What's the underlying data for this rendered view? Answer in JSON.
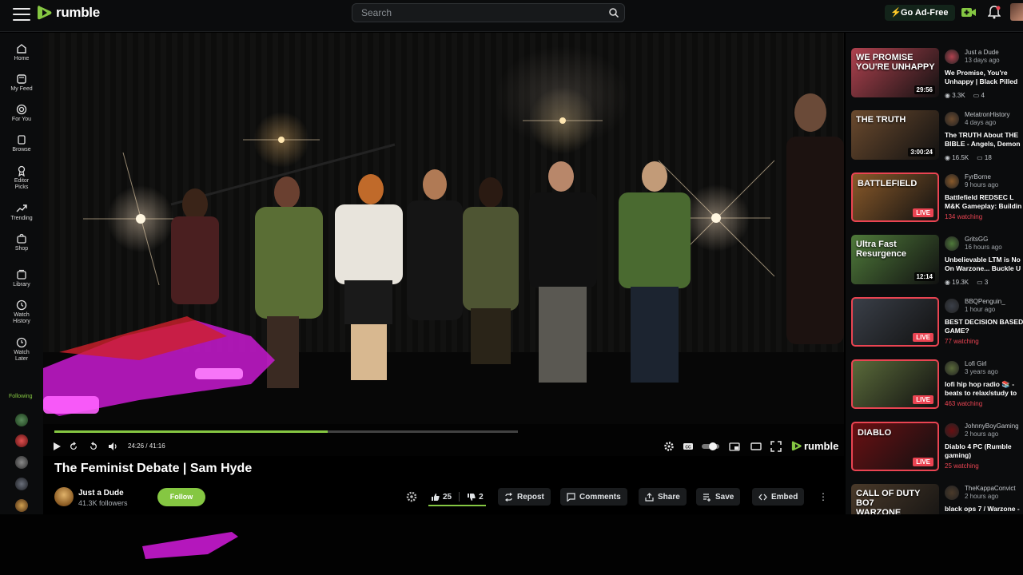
{
  "brand": {
    "name": "rumble"
  },
  "search": {
    "placeholder": "Search"
  },
  "header": {
    "ad_free_label": "Go Ad-Free"
  },
  "sidebar": {
    "items": [
      {
        "label": "Home",
        "icon": "home-icon"
      },
      {
        "label": "My Feed",
        "icon": "feed-icon"
      },
      {
        "label": "For You",
        "icon": "target-icon"
      },
      {
        "label": "Browse",
        "icon": "browse-icon"
      },
      {
        "label": "Editor Picks",
        "icon": "ribbon-icon"
      },
      {
        "label": "Trending",
        "icon": "trending-icon"
      },
      {
        "label": "Shop",
        "icon": "shop-icon"
      },
      {
        "label": "Library",
        "icon": "library-icon"
      },
      {
        "label": "Watch History",
        "icon": "history-icon"
      },
      {
        "label": "Watch Later",
        "icon": "clock-icon"
      }
    ],
    "following_label": "Following"
  },
  "player": {
    "time": "24:26 / 41:16",
    "progress": 0.59,
    "logo": "rumble"
  },
  "video": {
    "title": "The Feminist Debate | Sam Hyde",
    "channel": "Just a Dude",
    "followers": "41.3K followers",
    "follow_label": "Follow",
    "likes": "25",
    "dislikes": "2",
    "actions": {
      "repost": "Repost",
      "comments": "Comments",
      "share": "Share",
      "save": "Save",
      "embed": "Embed"
    }
  },
  "recommendations": [
    {
      "channel": "Just a Dude",
      "ago": "13 days ago",
      "title_lines": [
        "We Promise, You're",
        "Unhappy | Black Pilled"
      ],
      "thumb_text": "WE PROMISE\nYOU'RE UNHAPPY",
      "duration": "29:56",
      "views": "3.3K",
      "comments": "4",
      "live": false,
      "thumb_color": "#b0424f"
    },
    {
      "channel": "MetatronHistory",
      "ago": "4 days ago",
      "title_lines": [
        "The TRUTH About THE",
        "BIBLE - Angels, Demon"
      ],
      "thumb_text": "THE TRUTH",
      "duration": "3:00:24",
      "views": "16.5K",
      "comments": "18",
      "live": false,
      "thumb_color": "#6b4a2e"
    },
    {
      "channel": "FyrBorne",
      "ago": "9 hours ago",
      "title_lines": [
        "Battlefield REDSEC L",
        "M&K Gameplay: Buildin"
      ],
      "thumb_text": "BATTLEFIELD",
      "live": true,
      "live_label": "LIVE",
      "watching": "134 watching",
      "thumb_color": "#8a5a2a"
    },
    {
      "channel": "GritsGG",
      "ago": "16 hours ago",
      "title_lines": [
        "Unbelievable LTM is No",
        "On Warzone... Buckle U"
      ],
      "thumb_text": "Ultra Fast\nResurgence",
      "duration": "12:14",
      "views": "19.3K",
      "comments": "3",
      "live": false,
      "thumb_color": "#4f7a3a"
    },
    {
      "channel": "BBQPenguin_",
      "ago": "1 hour ago",
      "title_lines": [
        "BEST DECISION BASED",
        "GAME?"
      ],
      "thumb_text": "",
      "live": true,
      "live_label": "LIVE",
      "watching": "77 watching",
      "thumb_color": "#3a3f48"
    },
    {
      "channel": "Lofi Girl",
      "ago": "3 years ago",
      "title_lines": [
        "lofi hip hop radio 📚 -",
        "beats to relax/study to"
      ],
      "thumb_text": "",
      "live": true,
      "live_label": "LIVE",
      "watching": "463 watching",
      "thumb_color": "#5a6a3a"
    },
    {
      "channel": "JohnnyBoyGaming",
      "ago": "2 hours ago",
      "title_lines": [
        "Diablo 4 PC (Rumble",
        "gaming)"
      ],
      "thumb_text": "DIABLO",
      "live": true,
      "live_label": "LIVE",
      "watching": "25 watching",
      "thumb_color": "#6a0f12"
    },
    {
      "channel": "TheKappaConvict",
      "ago": "2 hours ago",
      "title_lines": [
        "black ops 7 / Warzone -",
        ""
      ],
      "thumb_text": "CALL OF DUTY\nBO7\nWARZONE",
      "live": false,
      "thumb_color": "#4a3a2a"
    }
  ],
  "colors": {
    "accent": "#85c742",
    "live": "#ea4452",
    "background": "#0b0c0d"
  }
}
